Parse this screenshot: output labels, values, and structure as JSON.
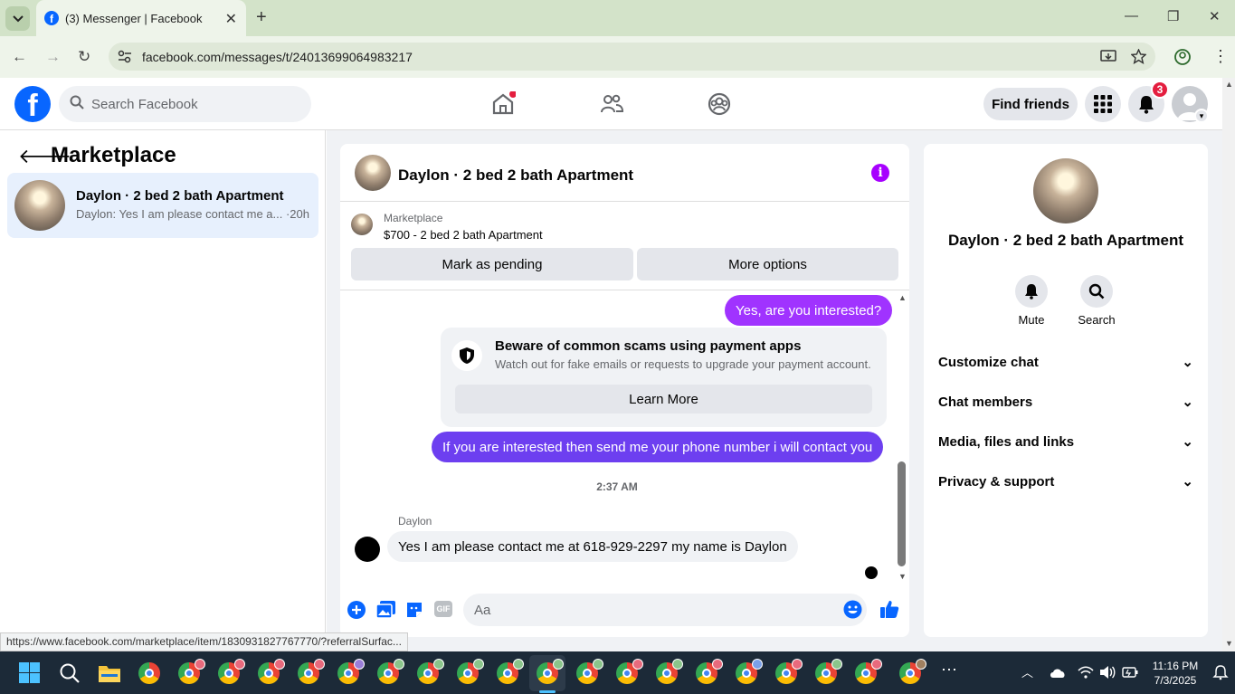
{
  "browser": {
    "tab_title": "(3) Messenger | Facebook",
    "url": "facebook.com/messages/t/24013699064983217",
    "status_url": "https://www.facebook.com/marketplace/item/1830931827767770/?referralSurfac..."
  },
  "header": {
    "search_placeholder": "Search Facebook",
    "find_friends": "Find friends",
    "notifications_count": "3"
  },
  "left": {
    "title": "Marketplace",
    "conversation": {
      "name": "Daylon · 2 bed 2 bath Apartment",
      "snippet": "Daylon: Yes I am please contact me a... ·20h"
    }
  },
  "chat": {
    "title": "Daylon · 2 bed 2 bath Apartment",
    "marketplace_label": "Marketplace",
    "listing": "$700 - 2 bed 2 bath Apartment",
    "mark_pending": "Mark as pending",
    "more_options": "More options",
    "messages": {
      "out1": "Yes, are you interested?",
      "scam_title": "Beware of common scams using payment apps",
      "scam_desc": "Watch out for fake emails or requests to upgrade your payment account.",
      "learn_more": "Learn More",
      "out2": "If you are interested then send me your phone number i will contact you",
      "timestamp": "2:37 AM",
      "sender": "Daylon",
      "in1": "Yes I am please contact me at 618-929-2297 my name is Daylon"
    },
    "composer_placeholder": "Aa"
  },
  "right": {
    "title": "Daylon · 2 bed 2 bath Apartment",
    "mute": "Mute",
    "search": "Search",
    "rows": [
      "Customize chat",
      "Chat members",
      "Media, files and links",
      "Privacy & support"
    ]
  },
  "taskbar": {
    "time": "11:16 PM",
    "date": "7/3/2025"
  },
  "colors": {
    "accent": "#0866ff",
    "outgoing_bubble": "#a033ff",
    "badge": "#e41e3f"
  }
}
